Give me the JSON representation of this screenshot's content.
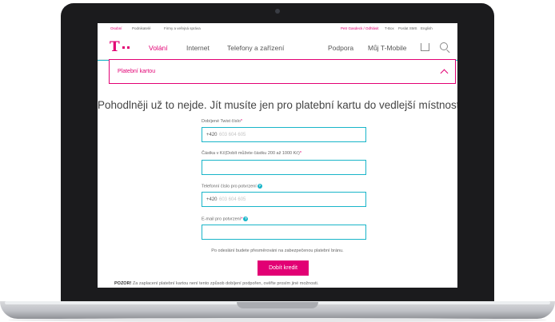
{
  "utility": {
    "left": [
      "Osobní",
      "Podnikatelé",
      "Firmy a veřejná správa"
    ],
    "right_pink": "Petr Gasdeck / Odhlásit",
    "right": [
      "T-Box",
      "Poslat SMS",
      "English"
    ]
  },
  "nav": {
    "links": [
      "Volání",
      "Internet",
      "Telefony a zařízení"
    ],
    "active": "Volání",
    "support": "Podpora",
    "my_account": "Můj T-Mobile"
  },
  "accordion_title": "Platební kartou",
  "headline": "Pohodlněji už to nejde. Jít musíte jen pro platební kartu do vedlejší místnosti.",
  "form": {
    "twist_label": "Dobíjené Twist číslo",
    "twist_prefix": "+420",
    "twist_placeholder": "603 604 605",
    "amount_label": "Částka v Kč(Dobít můžete částku 200 až 1000 Kč)",
    "phone_label": "Telefonní číslo pro potvrzení",
    "phone_prefix": "+420",
    "phone_placeholder": "603 604 605",
    "email_label": "E-mail pro potvrzení",
    "required_mark": "*",
    "info_glyph": "?"
  },
  "redirect_note": "Po odeslání budete přesměrováni na zabezpečenou platební bránu.",
  "submit_label": "Dobít kredit",
  "warning": {
    "bold": "POZOR!",
    "text": "Za zaplacení platební kartou není tento způsob dobíjení podpořen, ověřte prosím jiné možnosti."
  },
  "colors": {
    "magenta": "#e20074",
    "cyan": "#19b5c9"
  }
}
